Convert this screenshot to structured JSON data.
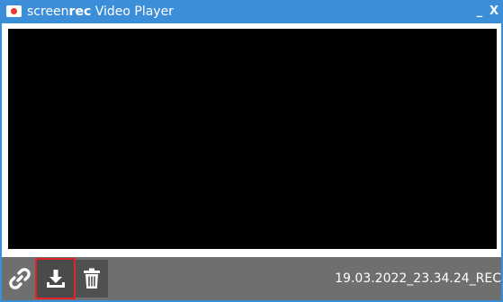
{
  "window": {
    "title_prefix": "screen",
    "title_brand": "rec",
    "title_suffix": " Video Player",
    "minimize_label": "_",
    "close_label": "X"
  },
  "toolbar": {
    "recording_name": "19.03.2022_23.34.24_REC",
    "buttons": [
      {
        "icon": "link-icon"
      },
      {
        "icon": "download-icon"
      },
      {
        "icon": "trash-icon"
      }
    ]
  },
  "colors": {
    "titlebar": "#3d8ed9",
    "video": "#000000",
    "toolbar": "#6f6f6f",
    "highlight": "#e0252a"
  }
}
